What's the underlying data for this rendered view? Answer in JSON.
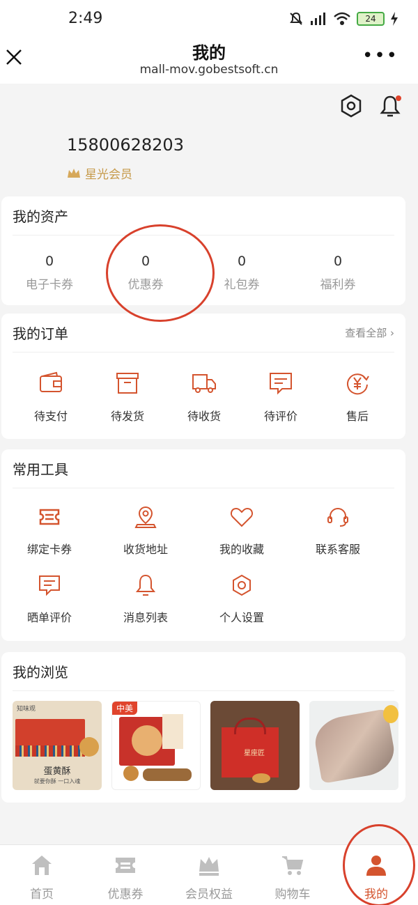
{
  "status_bar": {
    "time": "2:49",
    "battery": "24"
  },
  "title_bar": {
    "title": "我的",
    "url": "mall-mov.gobestsoft.cn"
  },
  "profile": {
    "phone": "15800628203",
    "member_level": "星光会员"
  },
  "assets": {
    "title": "我的资产",
    "items": [
      {
        "value": "0",
        "label": "电子卡券"
      },
      {
        "value": "0",
        "label": "优惠券"
      },
      {
        "value": "0",
        "label": "礼包券"
      },
      {
        "value": "0",
        "label": "福利券"
      }
    ]
  },
  "orders": {
    "title": "我的订单",
    "view_all": "查看全部",
    "items": [
      {
        "label": "待支付",
        "icon": "wallet-icon"
      },
      {
        "label": "待发货",
        "icon": "box-icon"
      },
      {
        "label": "待收货",
        "icon": "truck-icon"
      },
      {
        "label": "待评价",
        "icon": "comment-icon"
      },
      {
        "label": "售后",
        "icon": "yen-refund-icon"
      }
    ]
  },
  "tools": {
    "title": "常用工具",
    "items": [
      {
        "label": "绑定卡券",
        "icon": "ticket-icon"
      },
      {
        "label": "收货地址",
        "icon": "location-icon"
      },
      {
        "label": "我的收藏",
        "icon": "heart-icon"
      },
      {
        "label": "联系客服",
        "icon": "headset-icon"
      },
      {
        "label": "晒单评价",
        "icon": "comment-icon"
      },
      {
        "label": "消息列表",
        "icon": "bell-icon"
      },
      {
        "label": "个人设置",
        "icon": "settings-icon"
      }
    ]
  },
  "browse": {
    "title": "我的浏览",
    "items": [
      {
        "caption": "蛋黄酥",
        "subcaption": "就要你酥 一口入魂",
        "brand": "知味观"
      },
      {
        "caption": "",
        "badge": "中美"
      },
      {
        "caption": "星座匠"
      },
      {
        "caption": ""
      }
    ]
  },
  "tabbar": {
    "items": [
      {
        "label": "首页",
        "icon": "home-icon"
      },
      {
        "label": "优惠券",
        "icon": "coupon-icon"
      },
      {
        "label": "会员权益",
        "icon": "crown-icon"
      },
      {
        "label": "购物车",
        "icon": "cart-icon"
      },
      {
        "label": "我的",
        "icon": "user-icon",
        "active": true
      }
    ]
  },
  "colors": {
    "accent": "#d4542e",
    "gold": "#c69a4a",
    "annotation": "#d8412c"
  }
}
